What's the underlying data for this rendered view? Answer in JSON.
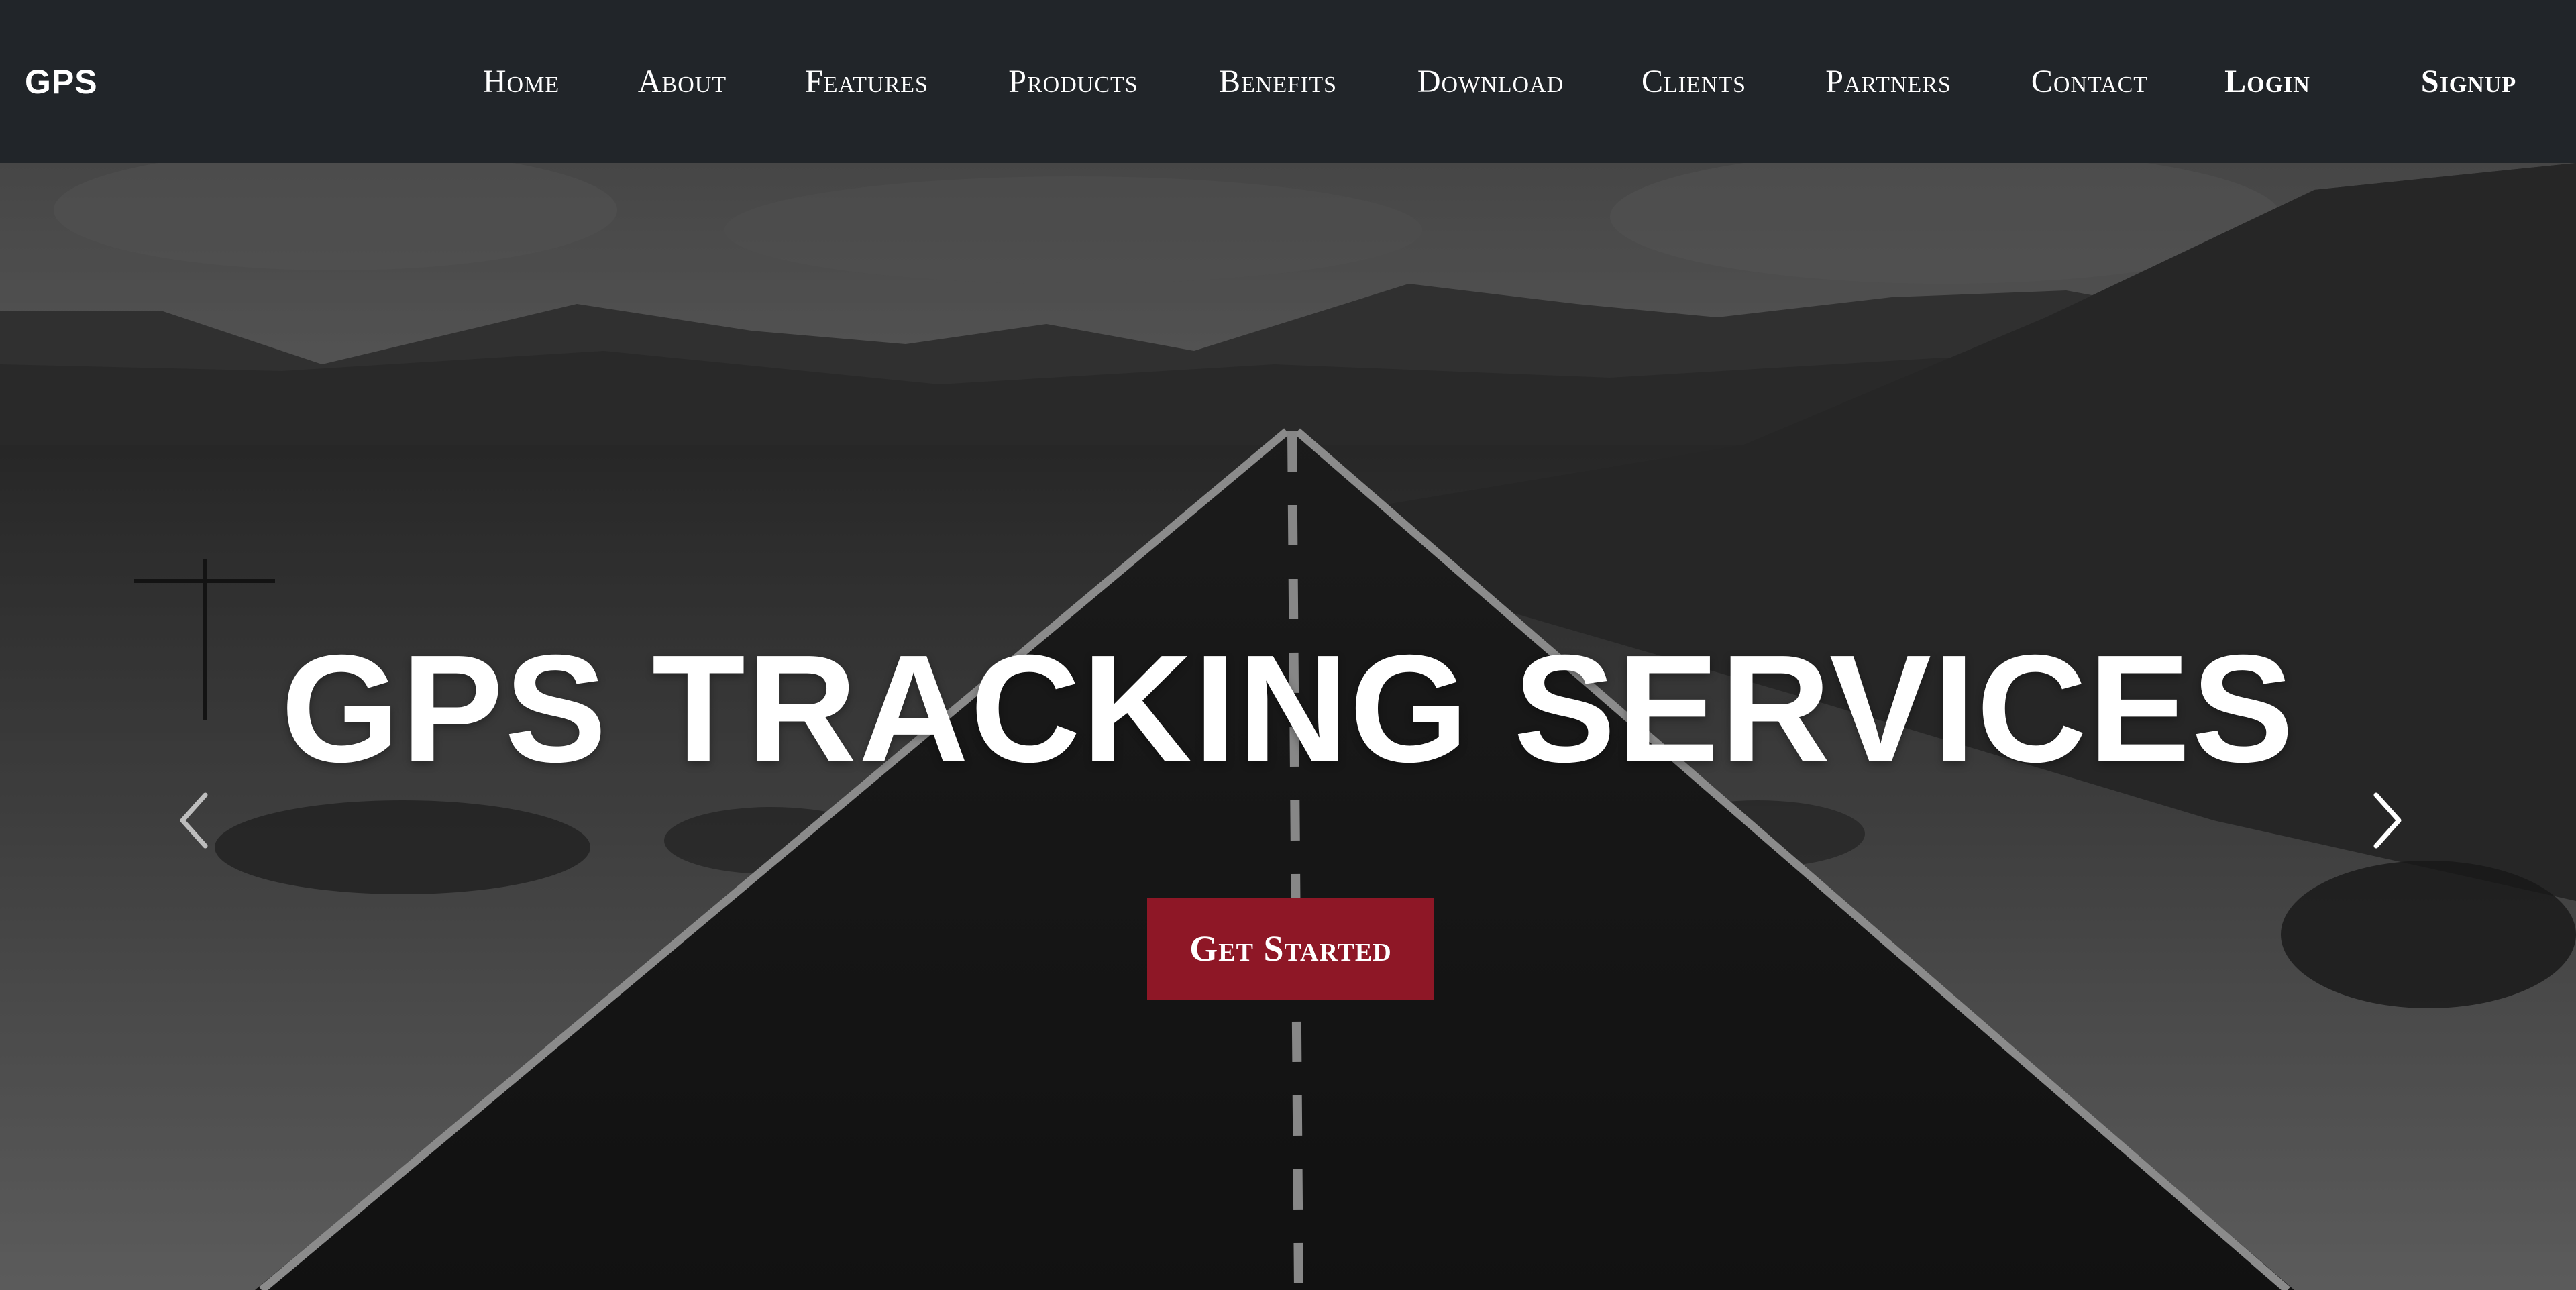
{
  "navbar": {
    "brand": "GPS",
    "links": [
      {
        "label": "Home"
      },
      {
        "label": "About"
      },
      {
        "label": "Features"
      },
      {
        "label": "Products"
      },
      {
        "label": "Benefits"
      },
      {
        "label": "Download"
      },
      {
        "label": "Clients"
      },
      {
        "label": "Partners"
      },
      {
        "label": "Contact"
      }
    ],
    "login_label": "Login",
    "signup_label": "Signup"
  },
  "hero": {
    "title": "GPS TRACKING SERVICES",
    "cta_label": "Get Started",
    "prev_icon": "chevron-left-icon",
    "next_icon": "chevron-right-icon",
    "background": "grayscale desert road photo"
  },
  "colors": {
    "navbar_bg": "#212529",
    "text": "#ffffff",
    "cta_bg": "#8e1726"
  }
}
